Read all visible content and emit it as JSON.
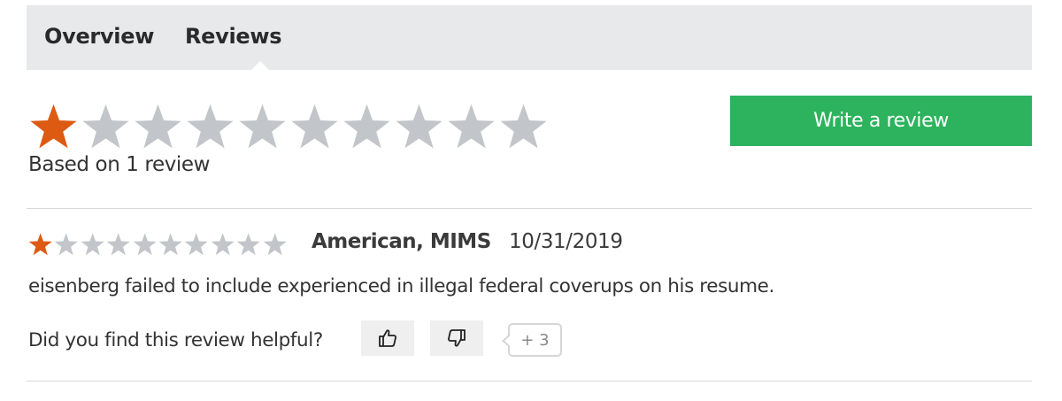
{
  "tabs": [
    {
      "label": "Overview",
      "active": false
    },
    {
      "label": "Reviews",
      "active": true
    }
  ],
  "summary": {
    "rating": 1,
    "max_rating": 10,
    "based_on": "Based on 1 review",
    "write_review_label": "Write a review"
  },
  "review": {
    "rating": 1,
    "max_rating": 10,
    "author": "American, MIMS",
    "date": "10/31/2019",
    "body": "eisenberg failed to include experienced in illegal federal coverups on his resume.",
    "helpful_question": "Did you find this review helpful?",
    "vote_count": "+ 3",
    "vote_up_icon": "thumbs-up-icon",
    "vote_down_icon": "thumbs-down-icon"
  },
  "colors": {
    "star_filled": "#dd5a12",
    "star_empty": "#c2c6ca",
    "write_button": "#2db35d",
    "tab_bar": "#e8e9eb"
  }
}
